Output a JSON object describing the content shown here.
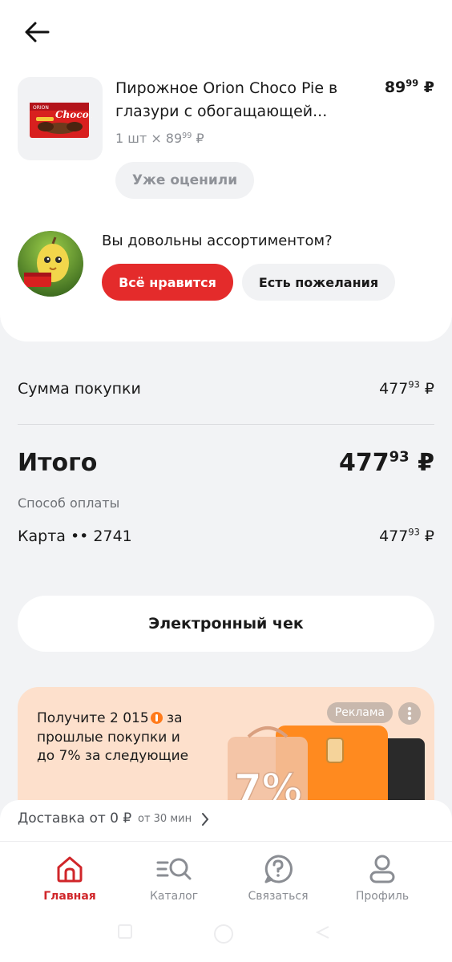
{
  "product": {
    "name": "Пирожное Orion Choco Pie в глазури с обогащающей...",
    "price_main": "89",
    "price_kop": "99",
    "currency": "₽",
    "qty_prefix": "1 шт  ×  89",
    "qty_kop": "99",
    "rated_label": "Уже оценили",
    "thumb_brand": "Choco Pie",
    "thumb_maker": "ORION"
  },
  "feedback": {
    "question": "Вы довольны ассортиментом?",
    "like_label": "Всё нравится",
    "wish_label": "Есть пожелания"
  },
  "summary": {
    "subtotal_label": "Сумма покупки",
    "subtotal_main": "477",
    "subtotal_kop": "93",
    "total_label": "Итого",
    "total_main": "477",
    "total_kop": "93",
    "payment_method_label": "Способ оплаты",
    "card_label": "Карта •• 2741",
    "card_main": "477",
    "card_kop": "93",
    "currency": "₽"
  },
  "receipt_button": "Электронный чек",
  "promo": {
    "text_line1": "Получите 2 015",
    "text_rest": "за прошлые покупки и до 7% за следующие",
    "ad_label": "Реклама",
    "graphic_text": "7%"
  },
  "delivery": {
    "text": "Доставка от 0 ₽",
    "time": "от 30 мин"
  },
  "tabs": [
    {
      "label": "Главная",
      "icon": "home-icon",
      "active": true
    },
    {
      "label": "Каталог",
      "icon": "catalog-search-icon",
      "active": false
    },
    {
      "label": "Связаться",
      "icon": "help-chat-icon",
      "active": false
    },
    {
      "label": "Профиль",
      "icon": "profile-icon",
      "active": false
    }
  ],
  "colors": {
    "accent_red": "#e42b2b",
    "promo_bg": "#fde0cc",
    "promo_orange": "#ff8a1f"
  }
}
